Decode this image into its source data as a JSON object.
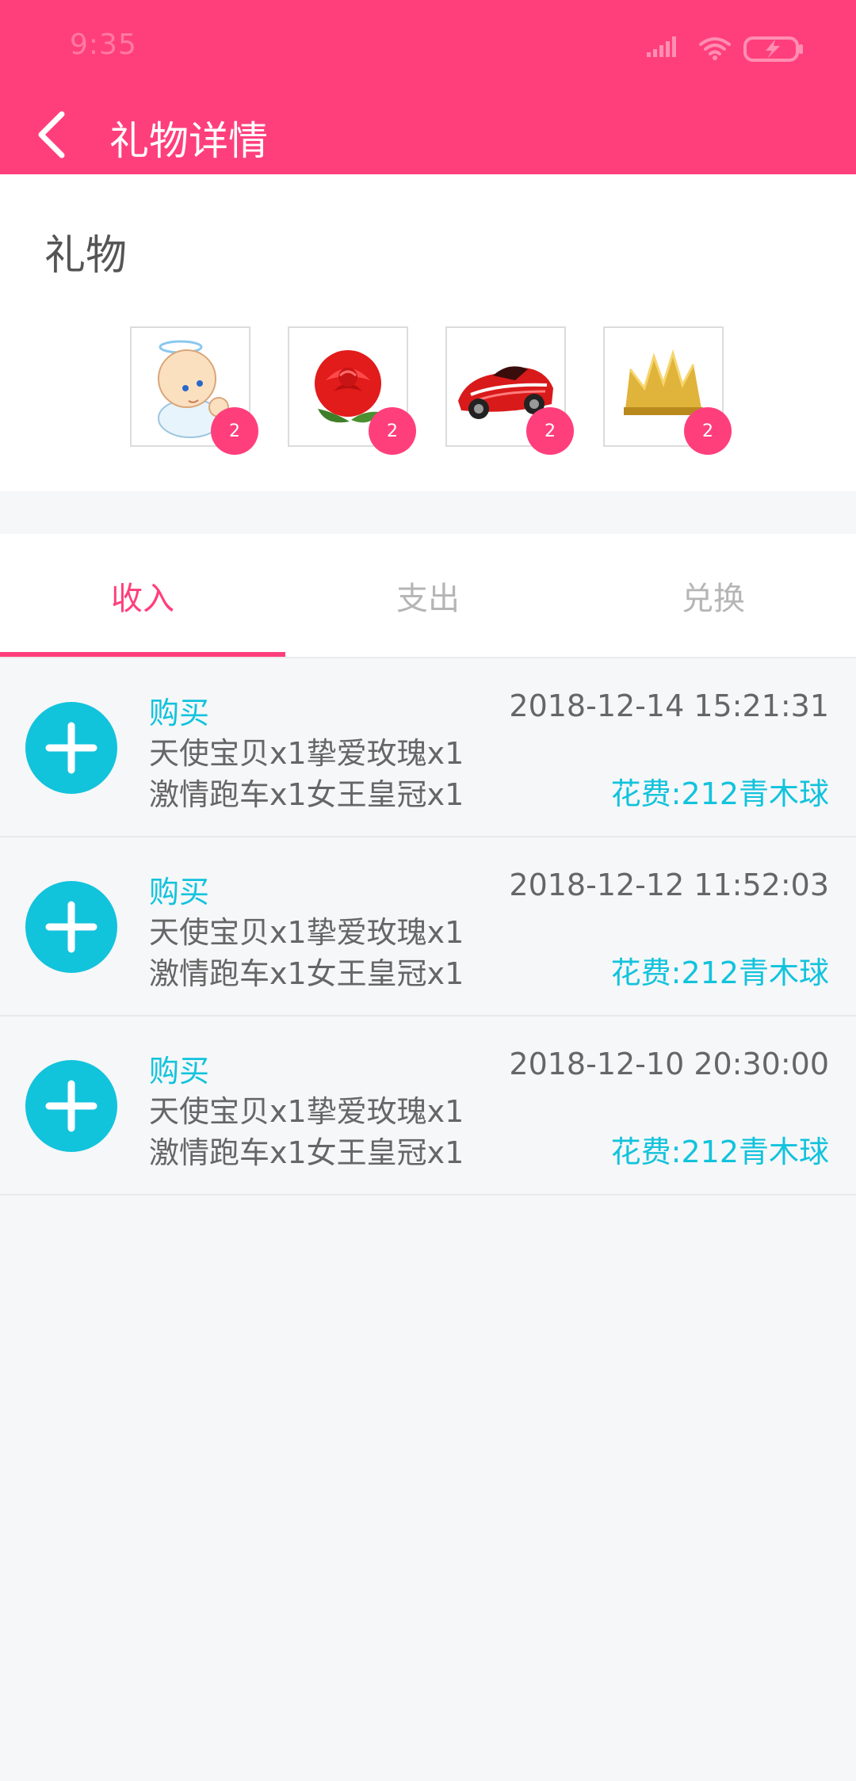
{
  "status_bar": {
    "time": "9:35"
  },
  "title_bar": {
    "title": "礼物详情"
  },
  "gifts": {
    "heading": "礼物",
    "items": [
      {
        "icon": "baby-angel-icon",
        "count": "2"
      },
      {
        "icon": "rose-icon",
        "count": "2"
      },
      {
        "icon": "sports-car-icon",
        "count": "2"
      },
      {
        "icon": "crown-icon",
        "count": "2"
      }
    ]
  },
  "tabs": [
    {
      "label": "收入",
      "active": true
    },
    {
      "label": "支出",
      "active": false
    },
    {
      "label": "兑换",
      "active": false
    }
  ],
  "records": [
    {
      "type": "购买",
      "items_line1": "天使宝贝x1挚爱玫瑰x1",
      "items_line2": "激情跑车x1女王皇冠x1",
      "time": "2018-12-14 15:21:31",
      "cost": "花费:212青木球"
    },
    {
      "type": "购买",
      "items_line1": "天使宝贝x1挚爱玫瑰x1",
      "items_line2": "激情跑车x1女王皇冠x1",
      "time": "2018-12-12 11:52:03",
      "cost": "花费:212青木球"
    },
    {
      "type": "购买",
      "items_line1": "天使宝贝x1挚爱玫瑰x1",
      "items_line2": "激情跑车x1女王皇冠x1",
      "time": "2018-12-10 20:30:00",
      "cost": "花费:212青木球"
    }
  ],
  "colors": {
    "primary": "#ff3f7c",
    "accent": "#12c3dc",
    "text": "#666666",
    "background": "#f6f7f9"
  }
}
